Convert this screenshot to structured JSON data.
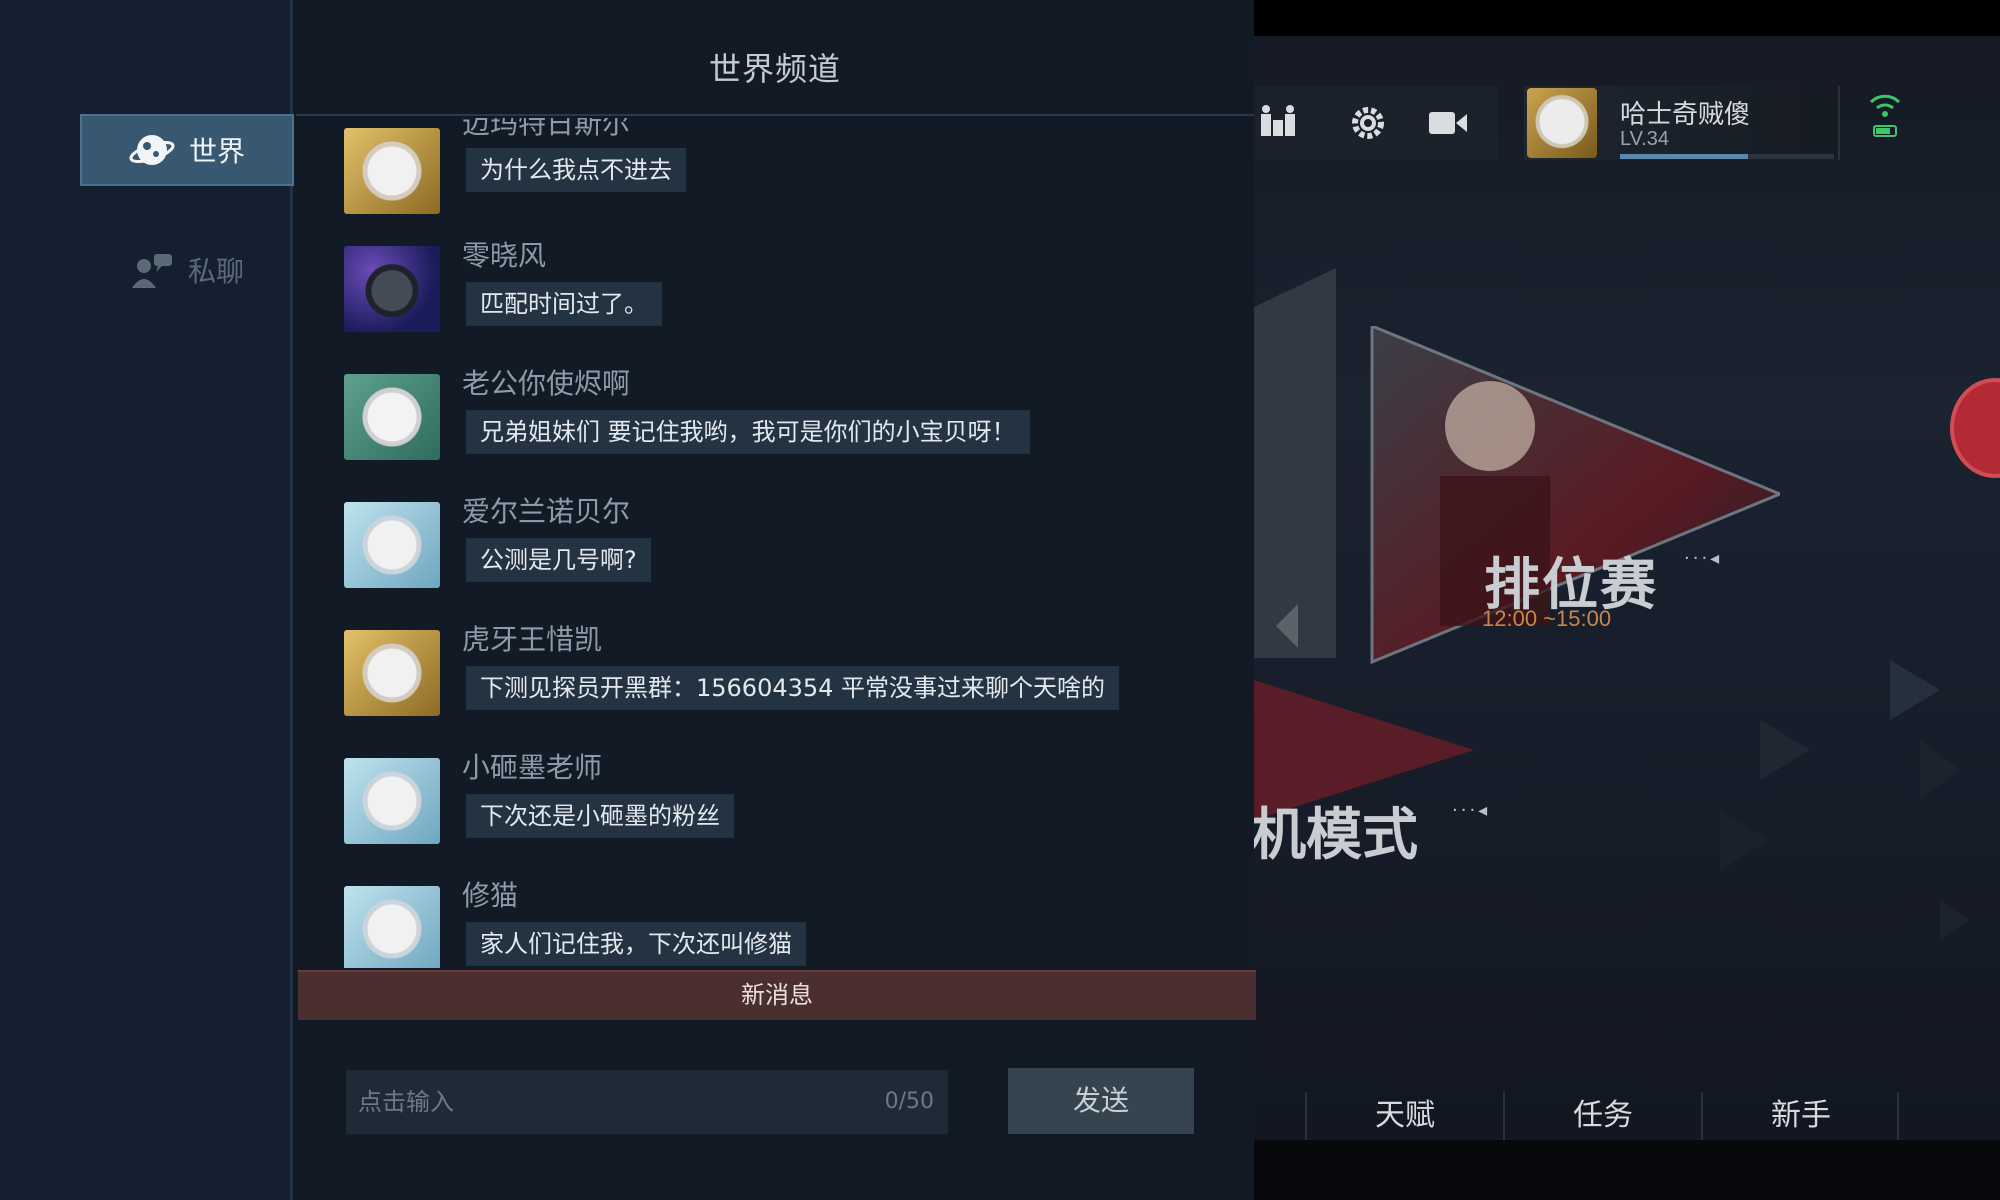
{
  "chat": {
    "title": "世界频道",
    "tabs": [
      {
        "label": "世界",
        "icon": "planet-icon",
        "active": true
      },
      {
        "label": "私聊",
        "icon": "chat-bubble-icon",
        "active": false
      }
    ],
    "messages": [
      {
        "name": "迈玛特日斯尔",
        "text": "为什么我点不进去",
        "avatar": "gold"
      },
      {
        "name": "零晓风",
        "text": "匹配时间过了。",
        "avatar": "dark"
      },
      {
        "name": "老公你使烬啊",
        "text": "兄弟姐妹们 要记住我哟，我可是你们的小宝贝呀！",
        "avatar": "green"
      },
      {
        "name": "爱尔兰诺贝尔",
        "text": "公测是几号啊?",
        "avatar": "blue"
      },
      {
        "name": "虎牙王惜凯",
        "text": "下测见探员开黑群：156604354 平常没事过来聊个天啥的",
        "avatar": "gold"
      },
      {
        "name": "小砸墨老师",
        "text": "下次还是小砸墨的粉丝",
        "avatar": "blue"
      },
      {
        "name": "修猫",
        "text": "家人们记住我，下次还叫修猫",
        "avatar": "blue"
      }
    ],
    "new_message_label": "新消息",
    "input": {
      "placeholder": "点击输入",
      "count": "0/50"
    },
    "send_label": "发送"
  },
  "game": {
    "player": {
      "name": "哈士奇贼傻",
      "level": "LV.34",
      "exp_progress": 0.6
    },
    "top_buttons": [
      "team-icon",
      "settings-gear-icon",
      "video-camera-icon"
    ],
    "ranked": {
      "title": "排位赛",
      "time": "12:00 ~15:00"
    },
    "mode": {
      "title": "机模式"
    },
    "bottom_tabs": [
      "天赋",
      "任务",
      "新手"
    ],
    "colors": {
      "accent": "#375870",
      "new_message_bar": "#4a2e30",
      "ranked_time": "#c9854a",
      "wifi": "#3fc46a"
    }
  }
}
